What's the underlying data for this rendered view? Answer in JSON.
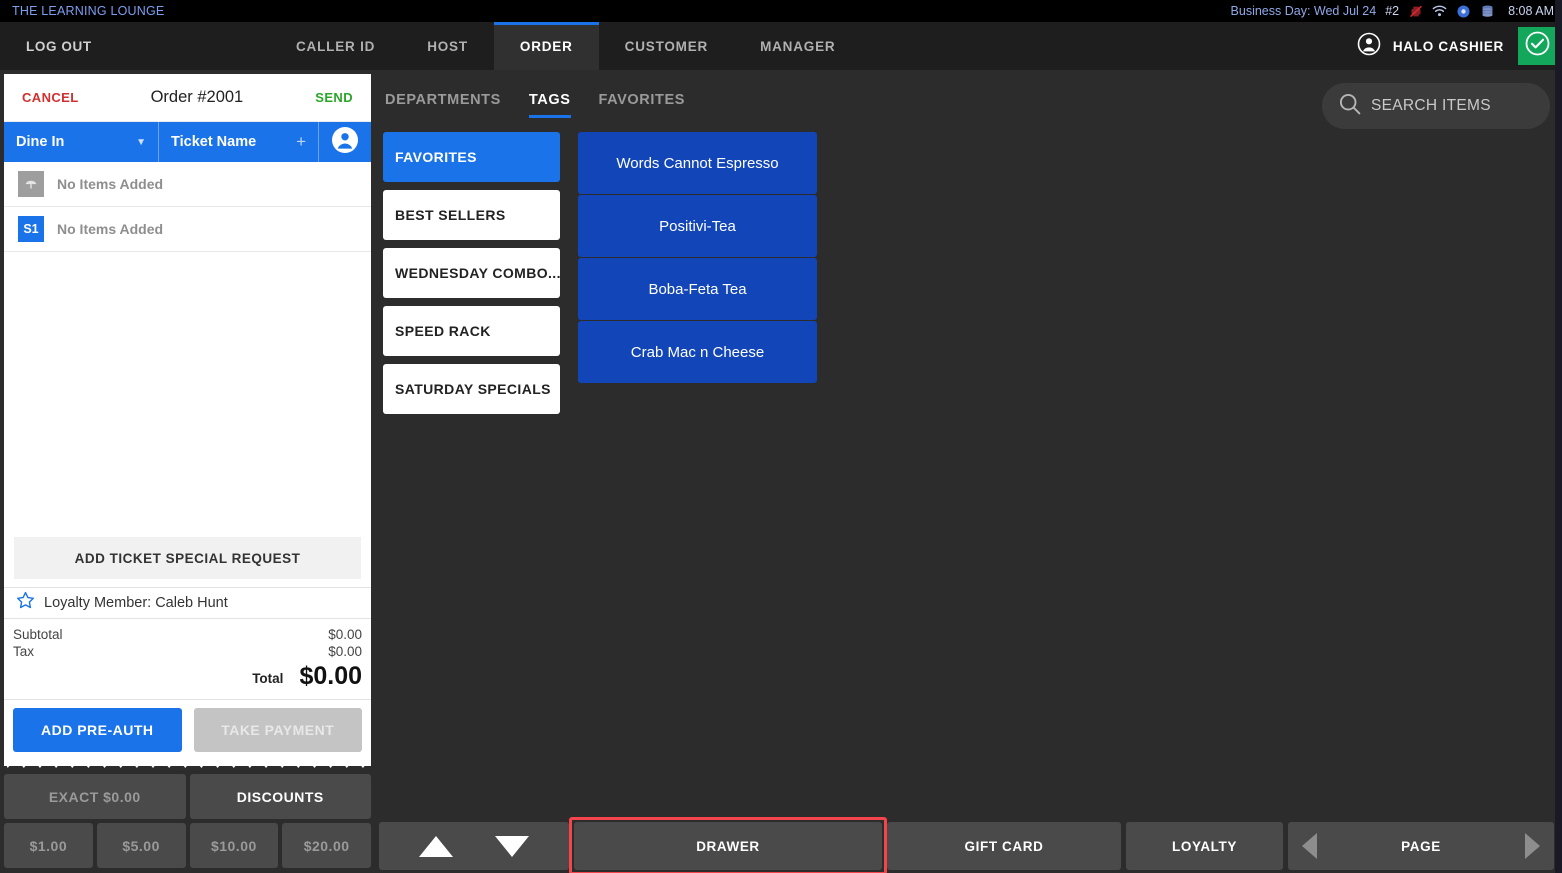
{
  "statusbar": {
    "brand": "THE LEARNING LOUNGE",
    "business_day": "Business Day: Wed Jul 24",
    "terminal": "#2",
    "time": "8:08 AM",
    "icons": [
      "printer-offline-icon",
      "wifi-icon",
      "status-dot-icon",
      "database-icon"
    ],
    "colors": {
      "brand_text": "#7b9ff0",
      "background": "#000000"
    }
  },
  "navbar": {
    "logout_label": "LOG OUT",
    "tabs": [
      {
        "label": "CALLER ID",
        "active": false
      },
      {
        "label": "HOST",
        "active": false
      },
      {
        "label": "ORDER",
        "active": true
      },
      {
        "label": "CUSTOMER",
        "active": false
      },
      {
        "label": "MANAGER",
        "active": false
      }
    ],
    "user_label": "HALO CASHIER",
    "confirm_color": "#12a75a",
    "active_underline_color": "#1a73e8"
  },
  "order_panel": {
    "cancel_label": "CANCEL",
    "title": "Order #2001",
    "send_label": "SEND",
    "order_type": "Dine In",
    "ticket_name_placeholder": "Ticket Name",
    "add_symbol": "+",
    "rows": [
      {
        "badge": "",
        "badge_type": "gray",
        "text": "No Items Added"
      },
      {
        "badge": "S1",
        "badge_type": "blue",
        "text": "No Items Added"
      }
    ],
    "special_request_label": "ADD TICKET SPECIAL REQUEST",
    "loyalty_label": "Loyalty Member: Caleb Hunt",
    "subtotal_label": "Subtotal",
    "subtotal_value": "$0.00",
    "tax_label": "Tax",
    "tax_value": "$0.00",
    "total_label": "Total",
    "total_value": "$0.00",
    "pre_auth_label": "ADD PRE-AUTH",
    "take_payment_label": "TAKE PAYMENT"
  },
  "keypad": {
    "exact_label": "EXACT $0.00",
    "discounts_label": "DISCOUNTS",
    "denominations": [
      "$1.00",
      "$5.00",
      "$10.00",
      "$20.00"
    ]
  },
  "content": {
    "tabs": [
      {
        "label": "DEPARTMENTS",
        "active": false
      },
      {
        "label": "TAGS",
        "active": true
      },
      {
        "label": "FAVORITES",
        "active": false
      }
    ],
    "search_placeholder": "SEARCH ITEMS",
    "tags": [
      {
        "label": "FAVORITES",
        "active": true
      },
      {
        "label": "BEST SELLERS",
        "active": false
      },
      {
        "label": "WEDNESDAY COMBO...",
        "active": false
      },
      {
        "label": "SPEED RACK",
        "active": false
      },
      {
        "label": "SATURDAY SPECIALS",
        "active": false
      }
    ],
    "items": [
      {
        "label": "Words Cannot Espresso"
      },
      {
        "label": "Positivi-Tea"
      },
      {
        "label": "Boba-Feta Tea"
      },
      {
        "label": "Crab Mac n Cheese"
      }
    ],
    "item_color": "#1246b8"
  },
  "bottombar": {
    "drawer_label": "DRAWER",
    "gift_card_label": "GIFT CARD",
    "loyalty_label": "LOYALTY",
    "page_label": "PAGE",
    "drawer_highlight_color": "#f4444c"
  }
}
